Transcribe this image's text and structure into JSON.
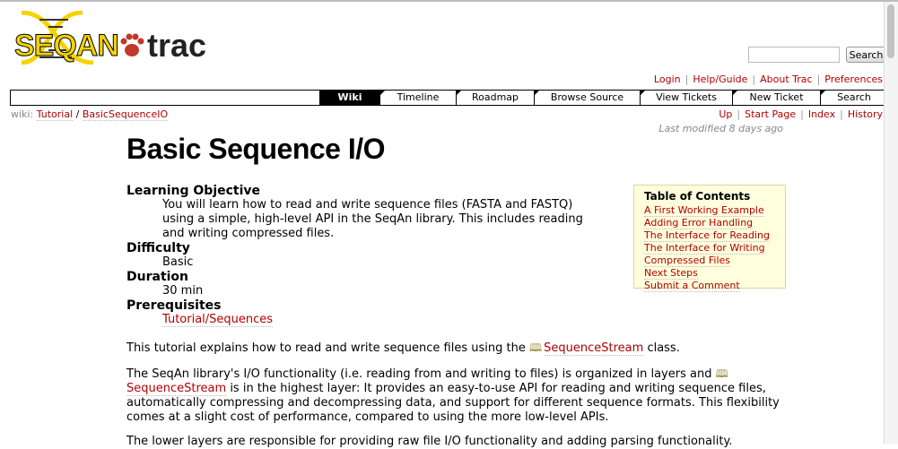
{
  "logo": {
    "seqan": "SEQAN",
    "trac": "trac"
  },
  "search": {
    "button": "Search"
  },
  "metanav": [
    "Login",
    "Help/Guide",
    "About Trac",
    "Preferences"
  ],
  "mainnav": [
    "Wiki",
    "Timeline",
    "Roadmap",
    "Browse Source",
    "View Tickets",
    "New Ticket",
    "Search"
  ],
  "breadcrumb": {
    "prefix": "wiki:",
    "items": [
      "Tutorial",
      "BasicSequenceIO"
    ],
    "sep": "/"
  },
  "ctxnav": [
    "Up",
    "Start Page",
    "Index",
    "History"
  ],
  "last_modified": "Last modified 8 days ago",
  "page_title": "Basic Sequence I/O",
  "defs": [
    {
      "term": "Learning Objective",
      "desc": "You will learn how to read and write sequence files (FASTA and FASTQ) using a simple, high-level API in the SeqAn library. This includes reading and writing compressed files."
    },
    {
      "term": "Difficulty",
      "desc": "Basic"
    },
    {
      "term": "Duration",
      "desc": "30 min"
    },
    {
      "term": "Prerequisites",
      "desc": "Tutorial/Sequences"
    }
  ],
  "para1": {
    "before": "This tutorial explains how to read and write sequence files using the",
    "link": "SequenceStream",
    "after": "class."
  },
  "para2": {
    "before": "The SeqAn library's I/O functionality (i.e. reading from and writing to files) is organized in layers and",
    "link": "SequenceStream",
    "after": "is in the highest layer: It provides an easy-to-use API for reading and writing sequence files, automatically compressing and decompressing data, and support for different sequence formats. This flexibility comes at a slight cost of performance, compared to using the more low-level APIs."
  },
  "para3": "The lower layers are responsible for providing raw file I/O functionality and adding parsing functionality.",
  "toc": {
    "title": "Table of Contents",
    "items": [
      "A First Working Example",
      "Adding Error Handling",
      "The Interface for Reading",
      "The Interface for Writing",
      "Compressed Files",
      "Next Steps",
      "Submit a Comment"
    ]
  },
  "colors": {
    "link": "#b00000",
    "toc_bg": "#ffffdd",
    "logo_yellow": "#f3d300"
  },
  "icons": {
    "book": "book-icon",
    "paw": "paw-icon"
  }
}
